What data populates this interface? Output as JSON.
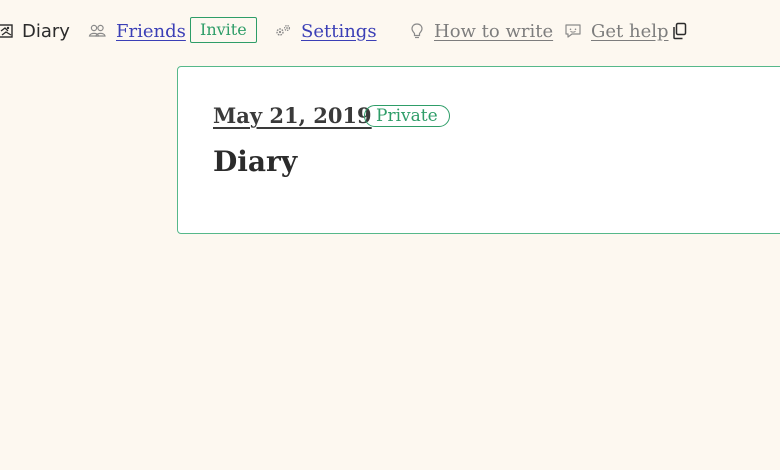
{
  "nav": {
    "diary_label": "Diary",
    "friends_label": "Friends",
    "invite_label": "Invite",
    "settings_label": "Settings",
    "how_to_write_label": "How to write",
    "get_help_label": "Get help"
  },
  "icons": {
    "diary": "image-icon",
    "friends": "people-icon",
    "settings": "gears-icon",
    "how_to_write": "lightbulb-icon",
    "get_help": "chat-icon",
    "copy": "copy-icon"
  },
  "card": {
    "date": "May 21, 2019",
    "privacy_badge": "Private",
    "title": "Diary"
  },
  "colors": {
    "background": "#fdf8f0",
    "accent_green": "#2e9d68",
    "link_blue": "#3b3fb6",
    "muted_gray": "#7d7d7d"
  }
}
